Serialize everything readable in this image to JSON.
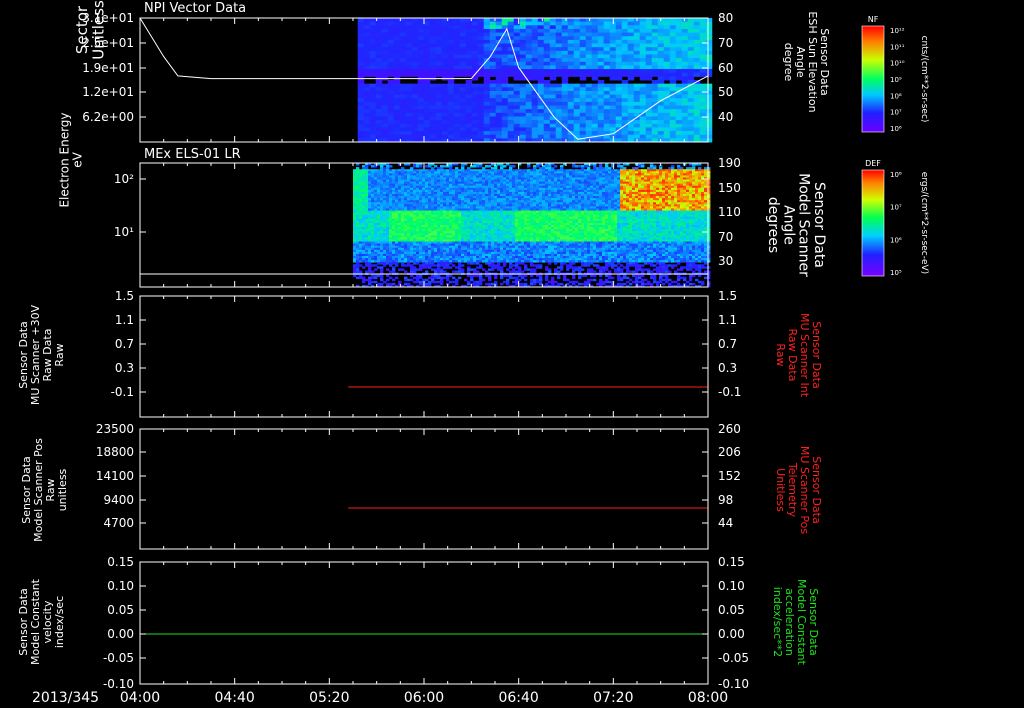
{
  "date_label": "2013/345",
  "x_ticks": [
    "04:00",
    "04:40",
    "05:20",
    "06:00",
    "06:40",
    "07:20",
    "08:00"
  ],
  "colors": {
    "white": "#ffffff",
    "red": "#ff2020",
    "green": "#20e020"
  },
  "chart_data": [
    {
      "type": "heatmap",
      "title": "NPI Vector Data",
      "ylabel_lines": [
        "Sector",
        "Unitless"
      ],
      "yticks": [
        "3.1e+01",
        "2.5e+01",
        "1.9e+01",
        "1.2e+01",
        "6.2e+00"
      ],
      "y2label_lines": [
        "Sensor Data",
        "ESH Sun Elevation",
        "Angle",
        "degree"
      ],
      "y2ticks": [
        "80",
        "70",
        "60",
        "50",
        "40"
      ],
      "data_start": "05:32",
      "overlay_line": {
        "name": "ESH Sun Elevation Angle",
        "x": [
          "04:00",
          "04:10",
          "04:16",
          "04:30",
          "05:00",
          "05:40",
          "06:20",
          "06:28",
          "06:35",
          "06:40",
          "06:55",
          "07:05",
          "07:20",
          "07:40",
          "08:00"
        ],
        "y": [
          80,
          66,
          59,
          58,
          58,
          58,
          58,
          66,
          76,
          62,
          44,
          36,
          38,
          50,
          59
        ]
      },
      "colorbar": {
        "label": "NF",
        "top": "10¹²",
        "ticks": [
          "10¹²",
          "10¹¹",
          "10¹⁰",
          "10⁹",
          "10⁸",
          "10⁷",
          "10⁶"
        ],
        "units": "cnts/(cm**2-sr-sec)"
      }
    },
    {
      "type": "heatmap",
      "title": "MEx ELS-01 LR",
      "ylabel_lines": [
        "Electron Energy",
        "eV"
      ],
      "yticks": [
        "10²",
        "10¹"
      ],
      "y2label_lines": [
        "Sensor Data",
        "Model Scanner",
        "Angle",
        "degrees"
      ],
      "y2ticks": [
        "190",
        "150",
        "110",
        "70",
        "30"
      ],
      "data_start": "05:30",
      "baseline": {
        "name": "Model Scanner Angle",
        "y": 2
      },
      "colorbar": {
        "label": "DEF",
        "top": "10⁸",
        "ticks": [
          "10⁸",
          "10⁷",
          "10⁶",
          "10⁵"
        ],
        "units": "ergs/(cm**2-sr-sec-eV)"
      }
    },
    {
      "type": "line",
      "ylabel_lines": [
        "Sensor Data",
        "MU Scanner +30V",
        "Raw Data",
        "Raw"
      ],
      "yticks": [
        "1.5",
        "1.1",
        "0.7",
        "0.3",
        "-0.1"
      ],
      "y2label_lines": [
        "Sensor Data",
        "MU Scanner Int",
        "Raw Data",
        "Raw"
      ],
      "y2ticks": [
        "1.5",
        "1.1",
        "0.7",
        "0.3",
        "-0.1"
      ],
      "series": [
        {
          "x": [
            "05:28",
            "08:00"
          ],
          "y": [
            0,
            0
          ],
          "color": "red"
        }
      ]
    },
    {
      "type": "line",
      "ylabel_lines": [
        "Sensor Data",
        "Model Scanner Pos",
        "Raw",
        "unitless"
      ],
      "yticks": [
        "23500",
        "18800",
        "14100",
        "9400",
        "4700"
      ],
      "y2label_lines": [
        "Sensor Data",
        "MU Scanner Pos",
        "Telemetry",
        "Unitless"
      ],
      "y2ticks": [
        "260",
        "206",
        "152",
        "98",
        "44"
      ],
      "series": [
        {
          "x": [
            "05:28",
            "08:00"
          ],
          "y": [
            87,
            87
          ],
          "color": "red"
        }
      ]
    },
    {
      "type": "line",
      "ylabel_lines": [
        "Sensor Data",
        "Model Constant",
        "velocity",
        "index/sec"
      ],
      "yticks": [
        "0.15",
        "0.10",
        "0.05",
        "0.00",
        "-0.05",
        "-0.10"
      ],
      "y2label_lines": [
        "Sensor Data",
        "Model Constant",
        "acceleration",
        "index/sec**2"
      ],
      "y2ticks": [
        "0.15",
        "0.10",
        "0.05",
        "0.00",
        "-0.05",
        "-0.10"
      ],
      "series": [
        {
          "x": [
            "04:00",
            "08:00"
          ],
          "y": [
            0,
            0
          ],
          "color": "green"
        }
      ]
    }
  ]
}
